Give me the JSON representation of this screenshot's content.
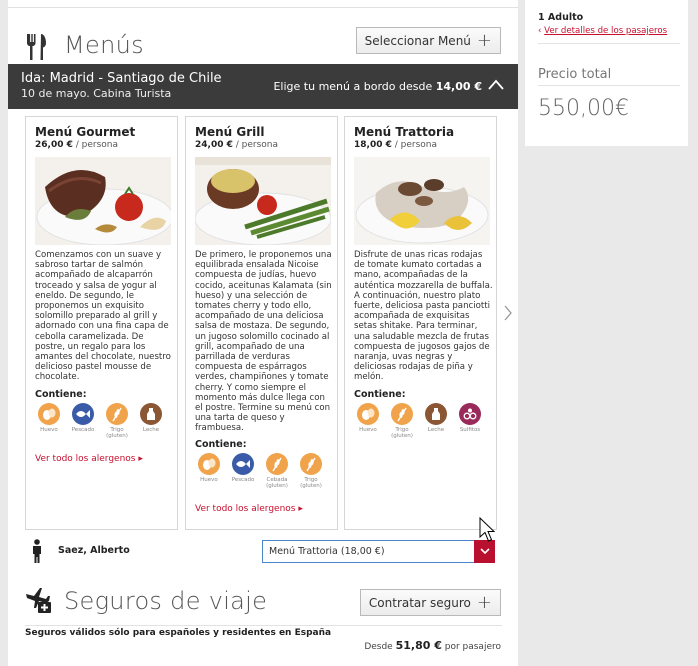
{
  "menus_section": {
    "title": "Menús",
    "select_button": "Seleccionar Menú"
  },
  "flight": {
    "route": "Ida: Madrid - Santiago de Chile",
    "date_cabin": "10 de mayo. Cabina Turista",
    "choose_prefix": "Elige tu menú a bordo desde ",
    "choose_price": "14,00 €"
  },
  "cards": [
    {
      "title": "Menú Gourmet",
      "price": "26,00 €",
      "per_person": " / persona",
      "description": "Comenzamos con un suave y sabroso tartar de salmón acompañado de alcaparrón troceado y salsa de yogur al eneldo. De segundo, le proponemos un exquisito solomillo preparado al grill y adornado con una fina capa de cebolla caramelizada. De postre, un regalo para los amantes del chocolate, nuestro delicioso pastel mousse de chocolate.",
      "contains_label": "Contiene:",
      "allergens": [
        {
          "name": "Huevo",
          "icon": "egg-icon",
          "color": "#f0a34a"
        },
        {
          "name": "Pescado",
          "icon": "fish-icon",
          "color": "#3a5ca8"
        },
        {
          "name": "Trigo (gluten)",
          "icon": "wheat-icon",
          "color": "#f0a34a"
        },
        {
          "name": "Leche",
          "icon": "milk-icon",
          "color": "#8a5634"
        }
      ],
      "link": "Ver todo los alergenos"
    },
    {
      "title": "Menú Grill",
      "price": "24,00 €",
      "per_person": " / persona",
      "description": "De primero, le proponemos una equilibrada ensalada Nicoise compuesta de judías, huevo cocido, aceitunas Kalamata (sin hueso) y una selección de tomates cherry y todo ello, acompañado de una deliciosa salsa de mostaza. De segundo, un jugoso solomillo cocinado al grill, acompañado de una parrillada de verduras compuesta de espárragos verdes, champiñones y tomate cherry. Y como siempre el momento más dulce llega con el postre. Termine su menú con una tarta de queso y frambuesa.",
      "contains_label": "Contiene:",
      "allergens": [
        {
          "name": "Huevo",
          "icon": "egg-icon",
          "color": "#f0a34a"
        },
        {
          "name": "Pescado",
          "icon": "fish-icon",
          "color": "#3a5ca8"
        },
        {
          "name": "Cebada (gluten)",
          "icon": "barley-icon",
          "color": "#f0a34a"
        },
        {
          "name": "Trigo (gluten)",
          "icon": "wheat-icon",
          "color": "#f0a34a"
        }
      ],
      "link": "Ver todo los alergenos"
    },
    {
      "title": "Menú Trattoria",
      "price": "18,00 €",
      "per_person": " / persona",
      "description": "Disfrute de unas ricas rodajas de tomate kumato cortadas a mano, acompañadas de la auténtica mozzarella de buffala. A continuación, nuestro plato fuerte, deliciosa pasta panciotti acompañada de exquisitas setas shitake. Para terminar, una saludable mezcla de frutas compuesta de jugosos gajos de naranja, uvas negras y deliciosas rodajas de piña y melón.",
      "contains_label": "Contiene:",
      "allergens": [
        {
          "name": "Huevo",
          "icon": "egg-icon",
          "color": "#f0a34a"
        },
        {
          "name": "Trigo (gluten)",
          "icon": "wheat-icon",
          "color": "#f0a34a"
        },
        {
          "name": "Leche",
          "icon": "milk-icon",
          "color": "#8a5634"
        },
        {
          "name": "Sulfitos",
          "icon": "sulfites-icon",
          "color": "#9a2a5a"
        }
      ],
      "link": ""
    }
  ],
  "passenger": {
    "name": "Saez, Alberto",
    "selected_menu": "Menú Trattoria (18,00 €)"
  },
  "insurance": {
    "title": "Seguros de viaje",
    "button": "Contratar seguro",
    "note": "Seguros válidos sólo para españoles y residentes en España",
    "price_prefix": "Desde ",
    "price": "51,80 €",
    "price_suffix": " por pasajero"
  },
  "sidebar": {
    "adults": "1 Adulto",
    "details_link": "Ver detalles de los pasajeros",
    "total_label": "Precio total",
    "total_value": "550,00€"
  },
  "colors": {
    "accent_red": "#c8102e",
    "dark_bar": "#3b3b3b"
  }
}
